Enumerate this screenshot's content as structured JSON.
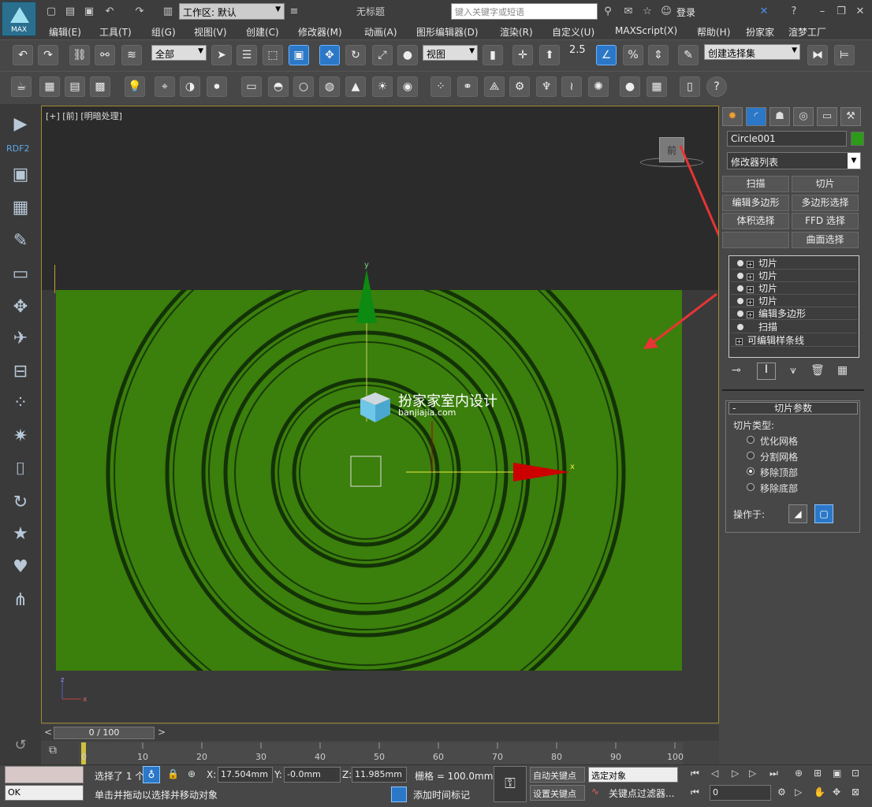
{
  "titlebar": {
    "app_badge": "MAX",
    "workspace_label": "工作区: 默认",
    "document_title": "无标题",
    "search_placeholder": "键入关键字或短语",
    "login_label": "登录"
  },
  "menus": [
    "编辑(E)",
    "工具(T)",
    "组(G)",
    "视图(V)",
    "创建(C)",
    "修改器(M)",
    "动画(A)",
    "图形编辑器(D)",
    "渲染(R)",
    "自定义(U)",
    "MAXScript(X)",
    "帮助(H)",
    "扮家家",
    "渲梦工厂"
  ],
  "toolbar": {
    "selection_filter": "全部",
    "reference_coord": "视图",
    "snap_value": "2.5",
    "named_selection": "创建选择集"
  },
  "leftbar": {
    "plugin_label": "RDF2"
  },
  "viewport": {
    "label": "[+] [前] [明暗处理]",
    "viewcube_label": "前",
    "gizmo_x": "x",
    "gizmo_y": "y",
    "axis_z": "z",
    "axis_x": "x",
    "watermark_title": "扮家家室内设计",
    "watermark_url": "banjiajia.com",
    "colors": {
      "plane": "#3b7f0c",
      "ring": "#0f2a06",
      "arrow": "#e83434",
      "gizmo_x": "#cc0000",
      "gizmo_y": "#0d8a12"
    }
  },
  "command_panel": {
    "object_name": "Circle001",
    "modifier_list": "修改器列表",
    "modifier_buttons": [
      "扫描",
      "切片",
      "编辑多边形",
      "多边形选择",
      "体积选择",
      "FFD 选择",
      "",
      "曲面选择"
    ],
    "stack": [
      {
        "label": "切片",
        "bulb": true,
        "plus": true
      },
      {
        "label": "切片",
        "bulb": true,
        "plus": true
      },
      {
        "label": "切片",
        "bulb": true,
        "plus": true
      },
      {
        "label": "切片",
        "bulb": true,
        "plus": true
      },
      {
        "label": "编辑多边形",
        "bulb": true,
        "plus": true
      },
      {
        "label": "扫描",
        "bulb": true,
        "plus": false
      },
      {
        "label": "可编辑样条线",
        "bulb": false,
        "plus": true
      }
    ],
    "rollout_title": "切片参数",
    "rollout_collapse": "-",
    "slice_type_label": "切片类型:",
    "slice_types": [
      {
        "label": "优化网格",
        "selected": false
      },
      {
        "label": "分割网格",
        "selected": false
      },
      {
        "label": "移除顶部",
        "selected": true
      },
      {
        "label": "移除底部",
        "selected": false
      }
    ],
    "operate_on_label": "操作于:"
  },
  "timeline": {
    "frame_display": "0 / 100",
    "ticks": [
      "0",
      "10",
      "20",
      "30",
      "40",
      "50",
      "60",
      "70",
      "80",
      "90",
      "100"
    ]
  },
  "statusbar": {
    "selection_info": "选择了 1 个",
    "x_label": "X:",
    "x_value": "17.504mm",
    "y_label": "Y:",
    "y_value": "-0.0mm",
    "z_label": "Z:",
    "z_value": "11.985mm",
    "grid_label": "栅格 = 100.0mm",
    "auto_key": "自动关键点",
    "set_key": "设置关键点",
    "key_mode": "选定对象",
    "key_filters": "关键点过滤器...",
    "current_frame": "0",
    "prompt": "单击并拖动以选择并移动对象",
    "add_time_tag": "添加时间标记",
    "ok_label": "OK"
  }
}
